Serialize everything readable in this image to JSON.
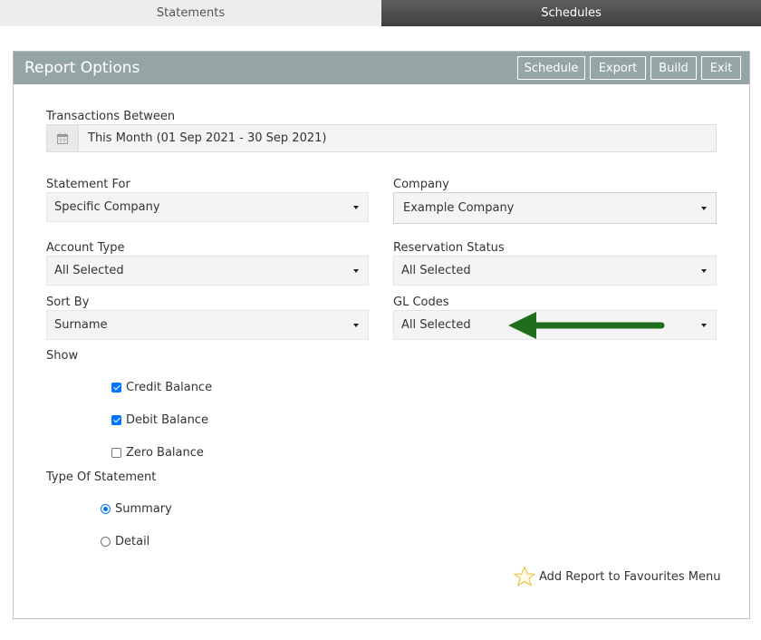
{
  "tabs": {
    "statements": "Statements",
    "schedules": "Schedules"
  },
  "header": {
    "title": "Report Options",
    "buttons": {
      "schedule": "Schedule",
      "export": "Export",
      "build": "Build",
      "exit": "Exit"
    }
  },
  "transactions": {
    "label": "Transactions Between",
    "value": "This Month (01 Sep 2021 - 30 Sep 2021)",
    "icon": "calendar-icon"
  },
  "fields": {
    "statement_for": {
      "label": "Statement For",
      "value": "Specific Company"
    },
    "company": {
      "label": "Company",
      "value": "Example Company"
    },
    "account_type": {
      "label": "Account Type",
      "value": "All Selected"
    },
    "reservation_status": {
      "label": "Reservation Status",
      "value": "All Selected"
    },
    "sort_by": {
      "label": "Sort By",
      "value": "Surname"
    },
    "gl_codes": {
      "label": "GL Codes",
      "value": "All Selected"
    }
  },
  "show": {
    "label": "Show",
    "options": [
      {
        "label": "Credit Balance",
        "checked": true
      },
      {
        "label": "Debit Balance",
        "checked": true
      },
      {
        "label": "Zero Balance",
        "checked": false
      }
    ]
  },
  "statement_type": {
    "label": "Type Of Statement",
    "options": [
      {
        "label": "Summary",
        "selected": true
      },
      {
        "label": "Detail",
        "selected": false
      }
    ]
  },
  "favourites": {
    "label": "Add Report to Favourites Menu",
    "icon": "star-icon"
  },
  "colors": {
    "header_bg": "#95a5a5",
    "active_tab_bg": "#4a4a4a",
    "annotation_arrow": "#1e6e1e",
    "checkbox_accent": "#0075ff"
  }
}
